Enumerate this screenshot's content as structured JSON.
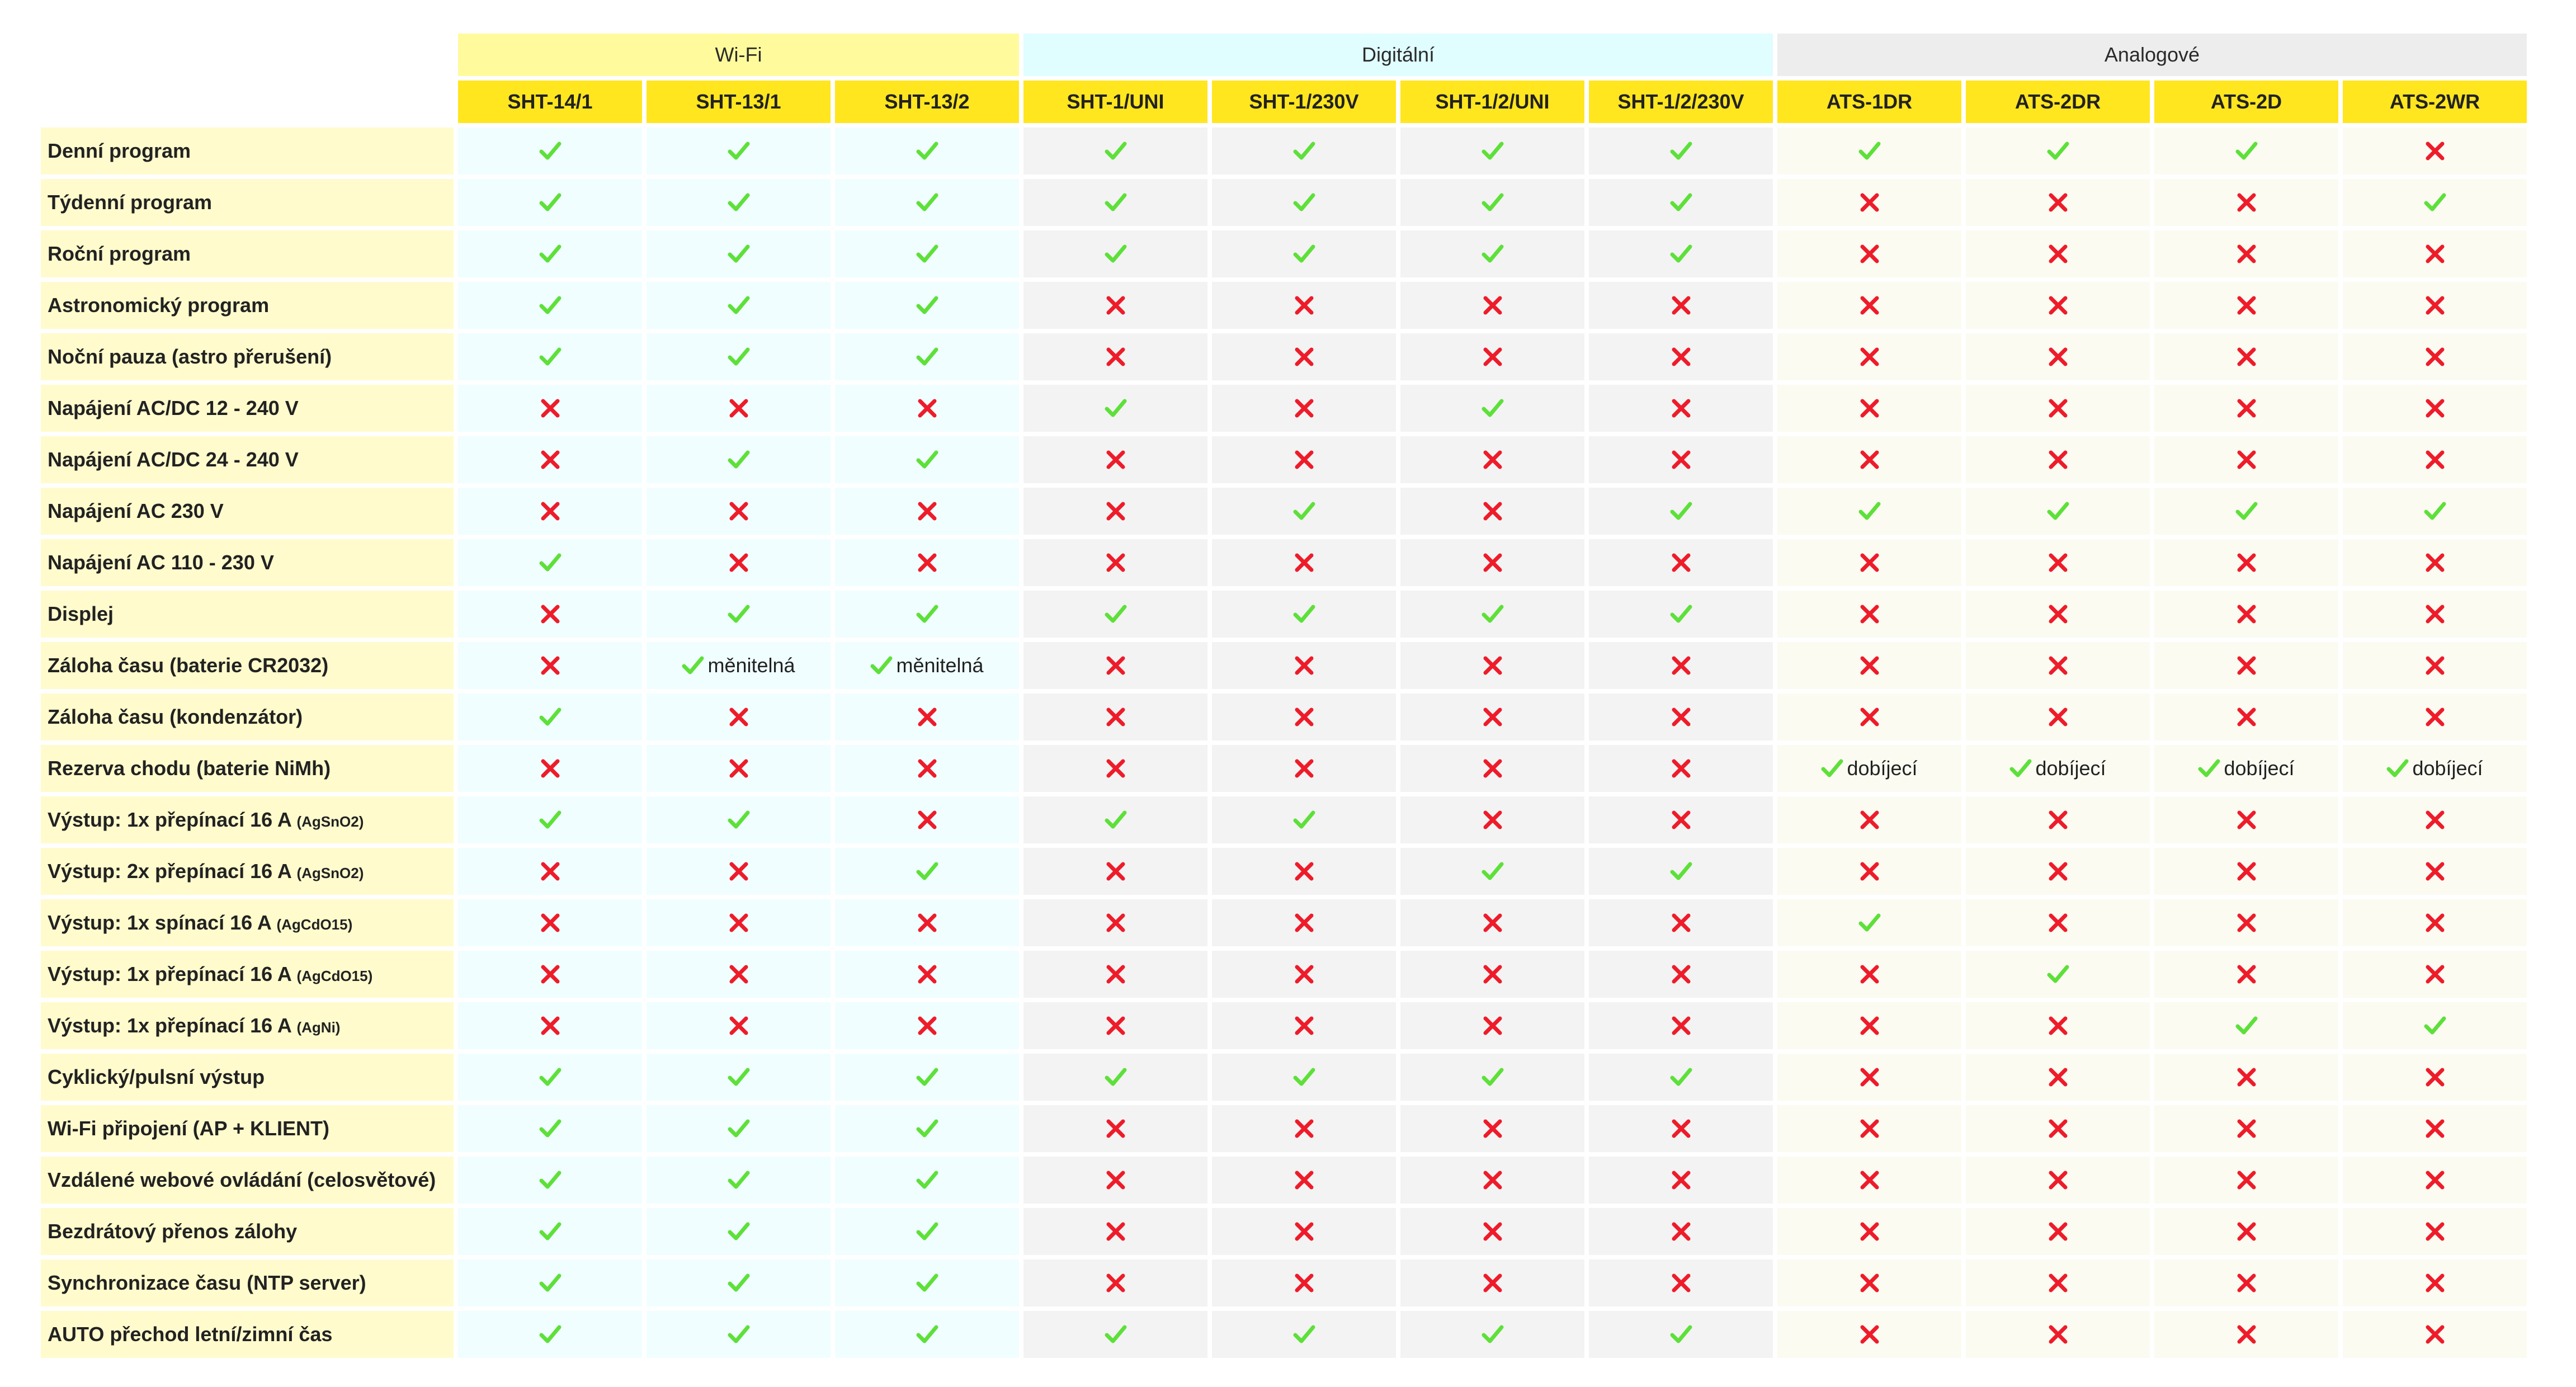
{
  "groups": [
    {
      "label": "Wi-Fi",
      "span": 3,
      "key": "wifi"
    },
    {
      "label": "Digitální",
      "span": 4,
      "key": "dig"
    },
    {
      "label": "Analogové",
      "span": 4,
      "key": "ana"
    }
  ],
  "models": [
    "SHT-14/1",
    "SHT-13/1",
    "SHT-13/2",
    "SHT-1/UNI",
    "SHT-1/230V",
    "SHT-1/2/UNI",
    "SHT-1/2/230V",
    "ATS-1DR",
    "ATS-2DR",
    "ATS-2D",
    "ATS-2WR"
  ],
  "model_groups": [
    "wifi",
    "wifi",
    "wifi",
    "dig",
    "dig",
    "dig",
    "dig",
    "ana",
    "ana",
    "ana",
    "ana"
  ],
  "colors": {
    "yes": "#5ee03a",
    "no": "#ee1c2a",
    "header": "#ffe61f",
    "feature_bg": "#fffbcc"
  },
  "icons": {
    "yes": "check-icon",
    "no": "cross-icon"
  },
  "rows": [
    {
      "feature": "Denní program",
      "sub": "",
      "values": [
        "y",
        "y",
        "y",
        "y",
        "y",
        "y",
        "y",
        "y",
        "y",
        "y",
        "n"
      ]
    },
    {
      "feature": "Týdenní program",
      "sub": "",
      "values": [
        "y",
        "y",
        "y",
        "y",
        "y",
        "y",
        "y",
        "n",
        "n",
        "n",
        "y"
      ]
    },
    {
      "feature": "Roční program",
      "sub": "",
      "values": [
        "y",
        "y",
        "y",
        "y",
        "y",
        "y",
        "y",
        "n",
        "n",
        "n",
        "n"
      ]
    },
    {
      "feature": "Astronomický program",
      "sub": "",
      "values": [
        "y",
        "y",
        "y",
        "n",
        "n",
        "n",
        "n",
        "n",
        "n",
        "n",
        "n"
      ]
    },
    {
      "feature": "Noční pauza (astro přerušení)",
      "sub": "",
      "values": [
        "y",
        "y",
        "y",
        "n",
        "n",
        "n",
        "n",
        "n",
        "n",
        "n",
        "n"
      ]
    },
    {
      "feature": "Napájení AC/DC 12 - 240 V",
      "sub": "",
      "values": [
        "n",
        "n",
        "n",
        "y",
        "n",
        "y",
        "n",
        "n",
        "n",
        "n",
        "n"
      ]
    },
    {
      "feature": "Napájení AC/DC 24 - 240 V",
      "sub": "",
      "values": [
        "n",
        "y",
        "y",
        "n",
        "n",
        "n",
        "n",
        "n",
        "n",
        "n",
        "n"
      ]
    },
    {
      "feature": "Napájení AC 230 V",
      "sub": "",
      "values": [
        "n",
        "n",
        "n",
        "n",
        "y",
        "n",
        "y",
        "y",
        "y",
        "y",
        "y"
      ]
    },
    {
      "feature": "Napájení AC 110 - 230 V",
      "sub": "",
      "values": [
        "y",
        "n",
        "n",
        "n",
        "n",
        "n",
        "n",
        "n",
        "n",
        "n",
        "n"
      ]
    },
    {
      "feature": "Displej",
      "sub": "",
      "values": [
        "n",
        "y",
        "y",
        "y",
        "y",
        "y",
        "y",
        "n",
        "n",
        "n",
        "n"
      ]
    },
    {
      "feature": "Záloha času (baterie CR2032)",
      "sub": "",
      "values": [
        "n",
        "y:měnitelná",
        "y:měnitelná",
        "n",
        "n",
        "n",
        "n",
        "n",
        "n",
        "n",
        "n"
      ]
    },
    {
      "feature": "Záloha času (kondenzátor)",
      "sub": "",
      "values": [
        "y",
        "n",
        "n",
        "n",
        "n",
        "n",
        "n",
        "n",
        "n",
        "n",
        "n"
      ]
    },
    {
      "feature": "Rezerva chodu (baterie NiMh)",
      "sub": "",
      "values": [
        "n",
        "n",
        "n",
        "n",
        "n",
        "n",
        "n",
        "y:dobíjecí",
        "y:dobíjecí",
        "y:dobíjecí",
        "y:dobíjecí"
      ]
    },
    {
      "feature": "Výstup: 1x přepínací 16 A ",
      "sub": "(AgSnO2)",
      "values": [
        "y",
        "y",
        "n",
        "y",
        "y",
        "n",
        "n",
        "n",
        "n",
        "n",
        "n"
      ]
    },
    {
      "feature": "Výstup: 2x přepínací 16 A ",
      "sub": "(AgSnO2)",
      "values": [
        "n",
        "n",
        "y",
        "n",
        "n",
        "y",
        "y",
        "n",
        "n",
        "n",
        "n"
      ]
    },
    {
      "feature": "Výstup: 1x spínací 16 A ",
      "sub": "(AgCdO15)",
      "values": [
        "n",
        "n",
        "n",
        "n",
        "n",
        "n",
        "n",
        "y",
        "n",
        "n",
        "n"
      ]
    },
    {
      "feature": "Výstup: 1x přepínací 16 A ",
      "sub": "(AgCdO15)",
      "values": [
        "n",
        "n",
        "n",
        "n",
        "n",
        "n",
        "n",
        "n",
        "y",
        "n",
        "n"
      ]
    },
    {
      "feature": "Výstup: 1x přepínací 16 A ",
      "sub": "(AgNi)",
      "values": [
        "n",
        "n",
        "n",
        "n",
        "n",
        "n",
        "n",
        "n",
        "n",
        "y",
        "y"
      ]
    },
    {
      "feature": "Cyklický/pulsní výstup",
      "sub": "",
      "values": [
        "y",
        "y",
        "y",
        "y",
        "y",
        "y",
        "y",
        "n",
        "n",
        "n",
        "n"
      ]
    },
    {
      "feature": "Wi-Fi připojení (AP + KLIENT)",
      "sub": "",
      "values": [
        "y",
        "y",
        "y",
        "n",
        "n",
        "n",
        "n",
        "n",
        "n",
        "n",
        "n"
      ]
    },
    {
      "feature": "Vzdálené webové ovládání (celosvětové)",
      "sub": "",
      "values": [
        "y",
        "y",
        "y",
        "n",
        "n",
        "n",
        "n",
        "n",
        "n",
        "n",
        "n"
      ]
    },
    {
      "feature": "Bezdrátový přenos zálohy",
      "sub": "",
      "values": [
        "y",
        "y",
        "y",
        "n",
        "n",
        "n",
        "n",
        "n",
        "n",
        "n",
        "n"
      ]
    },
    {
      "feature": "Synchronizace času (NTP server)",
      "sub": "",
      "values": [
        "y",
        "y",
        "y",
        "n",
        "n",
        "n",
        "n",
        "n",
        "n",
        "n",
        "n"
      ]
    },
    {
      "feature": "AUTO přechod letní/zimní čas",
      "sub": "",
      "values": [
        "y",
        "y",
        "y",
        "y",
        "y",
        "y",
        "y",
        "n",
        "n",
        "n",
        "n"
      ]
    }
  ]
}
